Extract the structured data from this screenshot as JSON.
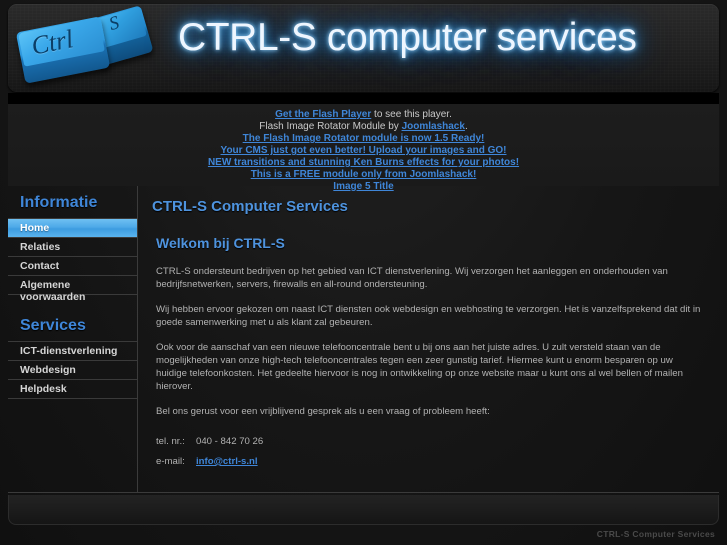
{
  "site": {
    "header_title": "CTRL-S computer services",
    "logo": {
      "key1_label": "Ctrl",
      "key2_label": "S"
    }
  },
  "flash_notice": {
    "line1_link": "Get the Flash Player",
    "line1_rest": " to see this player.",
    "line2_prefix": "Flash Image Rotator Module by ",
    "line2_link": "Joomlashack",
    "line2_suffix": ".",
    "line3": "The Flash Image Rotator module is now 1.5 Ready!",
    "line4": "Your CMS just got even better! Upload your images and GO!",
    "line5": "NEW transitions and stunning Ken Burns effects for your photos!",
    "line6": "This is a FREE module only from Joomlashack!",
    "line7": "Image 5 Title"
  },
  "sidebar": {
    "modules": [
      {
        "title": "Informatie",
        "items": [
          {
            "label": "Home",
            "active": true
          },
          {
            "label": "Relaties",
            "active": false
          },
          {
            "label": "Contact",
            "active": false
          },
          {
            "label": "Algemene voorwaarden",
            "active": false
          }
        ]
      },
      {
        "title": "Services",
        "items": [
          {
            "label": "ICT-dienstverlening",
            "active": false
          },
          {
            "label": "Webdesign",
            "active": false
          },
          {
            "label": "Helpdesk",
            "active": false
          }
        ]
      }
    ]
  },
  "main": {
    "page_title": "CTRL-S Computer Services",
    "article_heading": "Welkom bij CTRL-S",
    "paragraphs": [
      "CTRL-S ondersteunt bedrijven op het gebied van ICT dienstverlening. Wij verzorgen het aanleggen en onderhouden van bedrijfsnetwerken, servers, firewalls en all-round ondersteuning.",
      "Wij hebben ervoor gekozen om naast ICT diensten ook webdesign en webhosting te verzorgen. Het is vanzelfsprekend dat dit in goede samenwerking met u als klant zal gebeuren.",
      "Ook voor de aanschaf van een nieuwe telefooncentrale bent u bij ons aan het juiste adres. U zult versteld staan van de mogelijkheden van onze high-tech telefooncentrales tegen een zeer gunstig tarief. Hiermee kunt u enorm besparen op uw huidige telefoonkosten. Het gedeelte hiervoor is nog in ontwikkeling op onze website maar u kunt ons al wel bellen of mailen hierover.",
      "Bel ons gerust voor een vrijblijvend gesprek als u een vraag of probleem heeft:"
    ],
    "contact": {
      "phone_label": "tel. nr.:",
      "phone_value": "040 - 842 70 26",
      "email_label": "e-mail:",
      "email_value": "info@ctrl-s.nl"
    }
  },
  "footer": {
    "credit": "CTRL-S Computer Services"
  },
  "colors": {
    "accent_blue": "#3f86d8",
    "heading_blue": "#4e93de",
    "glow_blue": "#3ea7ef",
    "key_blue": "#2d97dc",
    "page_bg": "#141414"
  }
}
